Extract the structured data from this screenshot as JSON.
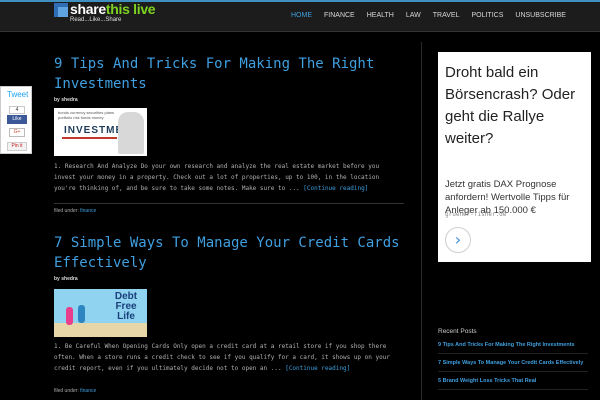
{
  "header": {
    "logo_main": "share",
    "logo_accent": "this live",
    "logo_tagline": "Read...Like...Share"
  },
  "nav": {
    "items": [
      {
        "label": "HOME"
      },
      {
        "label": "FINANCE"
      },
      {
        "label": "HEALTH"
      },
      {
        "label": "LAW"
      },
      {
        "label": "TRAVEL"
      },
      {
        "label": "POLITICS"
      },
      {
        "label": "UNSUBSCRIBE"
      }
    ],
    "active": "HOME"
  },
  "social": {
    "tweet": "Tweet",
    "fb_count": "4",
    "fb_like": "Like",
    "gplus": "G+",
    "pin": "Pin it"
  },
  "posts": [
    {
      "title": "9 Tips And Tricks For Making The Right Investments",
      "author_prefix": "by",
      "author": "shedra",
      "image_words": "bonds  currency\nsecurities  plans  portfolio\nrisk  funds  money",
      "image_heading": "INVESTMENT",
      "excerpt": "1. Research And Analyze Do your own research and analyze the real estate market before you invest your money in a property. Check out a lot of properties, up to 100, in the location you're thinking of, and be sure to take some notes. Make sure to ...",
      "more": "[Continue reading]",
      "filed_prefix": "filed under:",
      "category": "finance"
    },
    {
      "title": "7 Simple Ways To Manage Your Credit Cards Effectively",
      "author_prefix": "by",
      "author": "shedra",
      "image_heading": "Debt Free Life",
      "excerpt": "1. Be Careful When Opening Cards Only open a credit card at a retail store if you shop there often. When a store runs a credit check to see if you qualify for a card, it shows up on your credit report, even if you ultimately decide not to open an ...",
      "more": "[Continue reading]",
      "filed_prefix": "filed under:",
      "category": "finance"
    }
  ],
  "sidebar": {
    "ad": {
      "headline": "Droht bald ein Börsencrash? Oder geht die Rallye weiter?",
      "sub": "Jetzt gratis DAX Prognose anfordern! Wertvolle Tipps für Anleger ab 150.000 €",
      "domain": "gruener-fisher.de",
      "cta": "›"
    },
    "recent_title": "Recent Posts",
    "recent": [
      {
        "label": "9 Tips And Tricks For Making The Right Investments"
      },
      {
        "label": "7 Simple Ways To Manage Your Credit Cards Effectively"
      },
      {
        "label": "5 Brand Weight Loss Tricks That Real"
      }
    ]
  },
  "colors": {
    "accent": "#3f9fdf",
    "background": "#000000",
    "logo_green": "#7ed321"
  }
}
